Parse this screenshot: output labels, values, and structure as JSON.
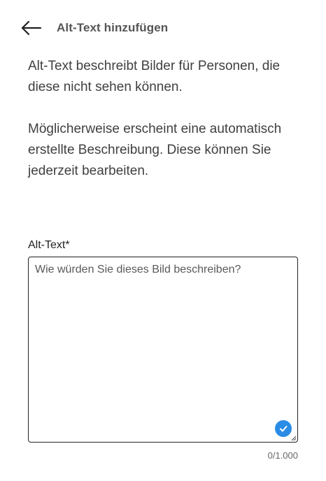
{
  "header": {
    "back_icon": "arrow-left-icon",
    "title": "Alt-Text hinzufügen"
  },
  "description": {
    "paragraph_1": "Alt-Text beschreibt Bilder für Personen, die diese nicht sehen können.",
    "paragraph_2": "Möglicherweise erscheint eine automatisch erstellte Beschreibung. Diese können Sie jederzeit bearbeiten."
  },
  "alt_text_field": {
    "label": "Alt-Text*",
    "value": "",
    "placeholder": "Wie würden Sie dieses Bild beschreiben?",
    "status_icon": "check-circle-icon",
    "status_color": "#2b8ce6",
    "char_count": "0/1.000"
  }
}
